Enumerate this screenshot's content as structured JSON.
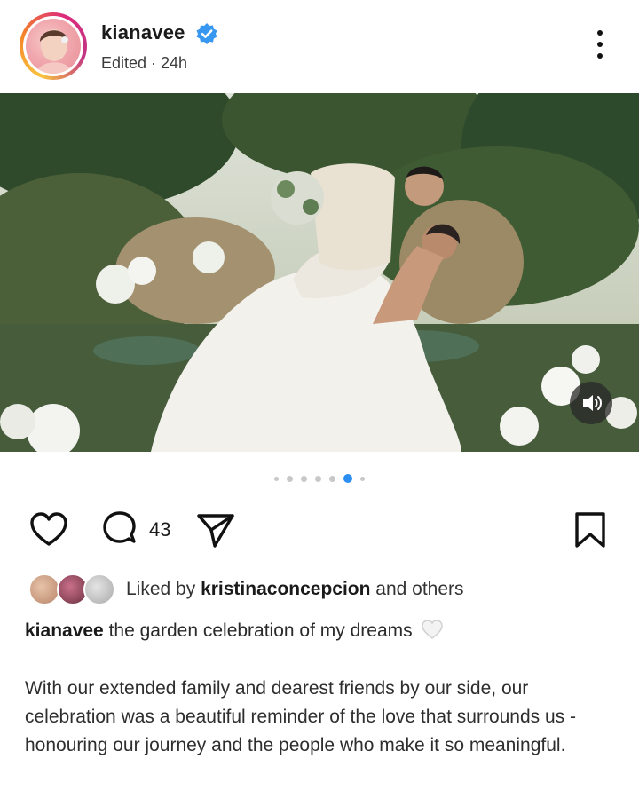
{
  "post": {
    "username": "kianavee",
    "verified": true,
    "meta": "Edited · 24h",
    "carousel": {
      "total_dots": 7,
      "active_index": 5
    },
    "actions": {
      "comment_count": "43"
    },
    "likes": {
      "prefix": "Liked by",
      "user": "kristinaconcepcion",
      "suffix": "and others"
    },
    "caption": {
      "username": "kianavee",
      "text": "the garden celebration of my dreams"
    },
    "body": "With our extended family and dearest friends by our side, our celebration was a beautiful reminder of the love that surrounds us - honouring our journey and the people who make it so meaningful."
  },
  "icons": {
    "more": "more-vertical-icon",
    "verified": "verified-badge-icon",
    "sound": "speaker-icon",
    "like": "heart-icon",
    "comment": "comment-icon",
    "share": "send-icon",
    "save": "bookmark-icon",
    "caption_emoji": "white-heart-icon"
  },
  "colors": {
    "accent": "#2b8ef0",
    "verified": "#3897f0"
  }
}
